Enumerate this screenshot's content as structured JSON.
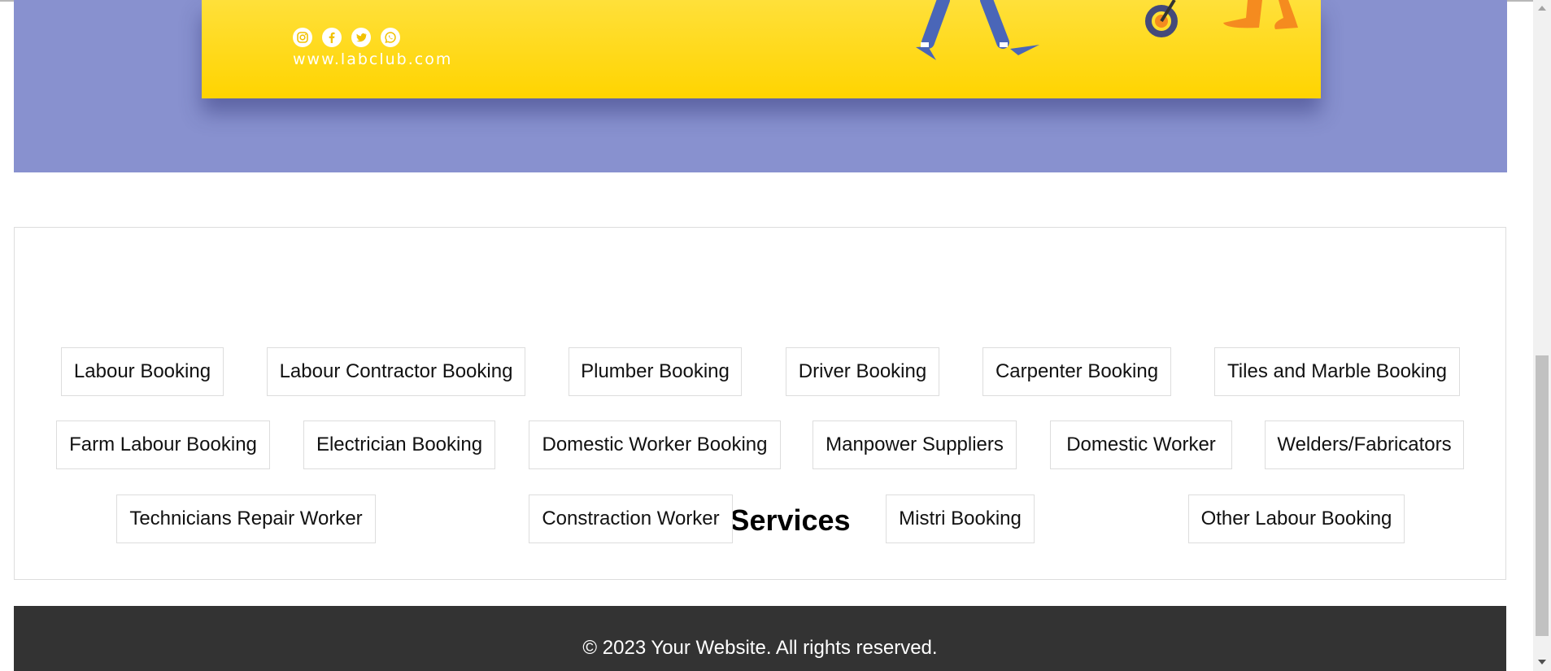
{
  "banner": {
    "url": "www.labclub.com",
    "social_icons": [
      "instagram-icon",
      "facebook-icon",
      "twitter-icon",
      "whatsapp-icon"
    ]
  },
  "colors": {
    "hero_band": "#8891cf",
    "banner_yellow": "#ffd400",
    "footer_bg": "#333333"
  },
  "services": {
    "title": "Our Services",
    "items": [
      "Labour Booking",
      "Labour Contractor Booking",
      "Plumber Booking",
      "Driver Booking",
      "Carpenter Booking",
      "Tiles and Marble Booking",
      "Farm Labour Booking",
      "Electrician Booking",
      "Domestic Worker Booking",
      "Manpower Suppliers",
      "Domestic Worker",
      "Welders/Fabricators",
      "Technicians Repair Worker",
      "Constraction Worker",
      "Mistri Booking",
      "Other Labour Booking"
    ]
  },
  "footer": {
    "text": "© 2023 Your Website. All rights reserved."
  }
}
